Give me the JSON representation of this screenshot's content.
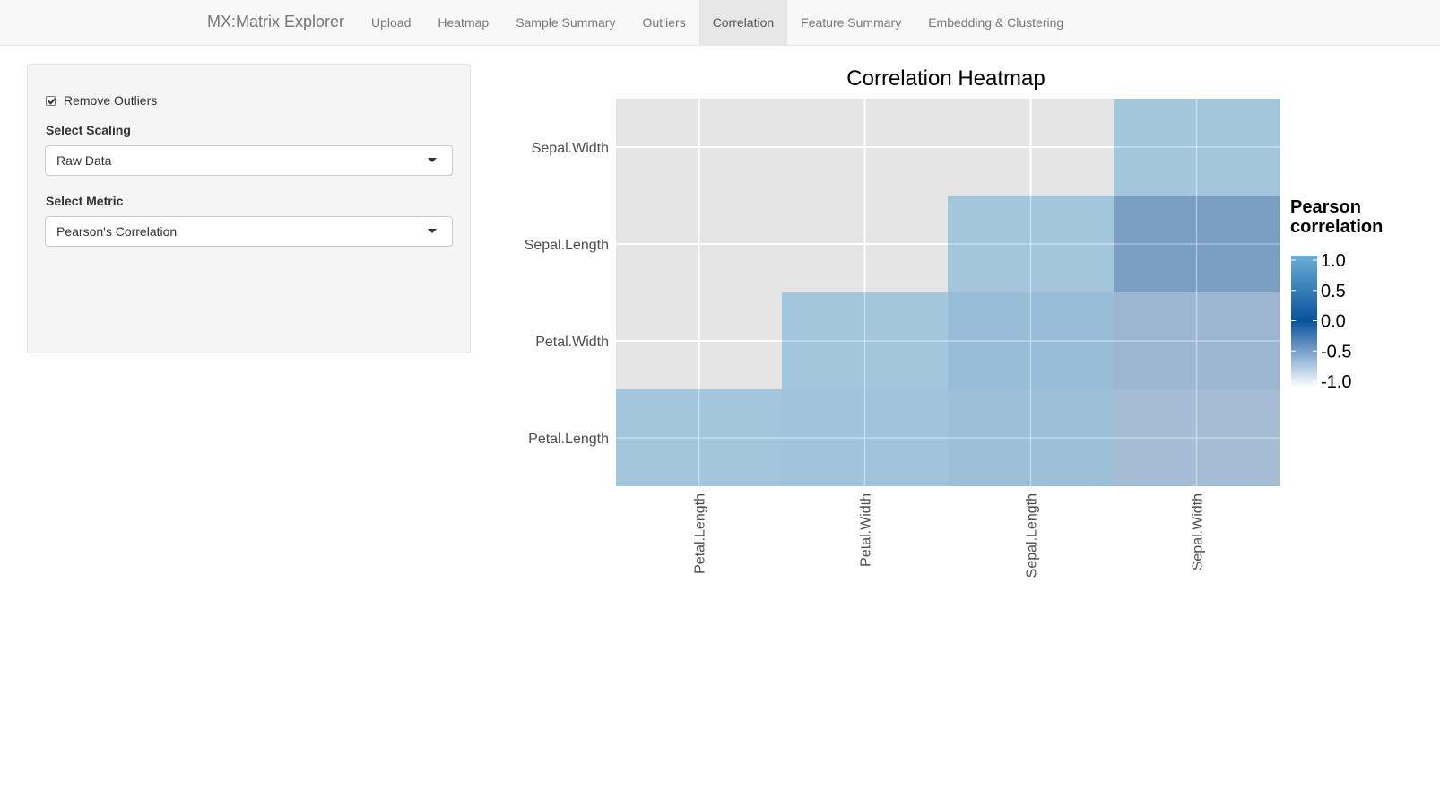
{
  "navbar": {
    "brand": "MX:Matrix Explorer",
    "tabs": [
      {
        "label": "Upload",
        "active": false
      },
      {
        "label": "Heatmap",
        "active": false
      },
      {
        "label": "Sample Summary",
        "active": false
      },
      {
        "label": "Outliers",
        "active": false
      },
      {
        "label": "Correlation",
        "active": true
      },
      {
        "label": "Feature Summary",
        "active": false
      },
      {
        "label": "Embedding & Clustering",
        "active": false
      }
    ]
  },
  "sidebar": {
    "remove_outliers_label": "Remove Outliers",
    "remove_outliers_checked": true,
    "scaling_label": "Select Scaling",
    "scaling_value": "Raw Data",
    "metric_label": "Select Metric",
    "metric_value": "Pearson's Correlation"
  },
  "chart_data": {
    "type": "heatmap",
    "title": "Correlation Heatmap",
    "x_categories": [
      "Petal.Length",
      "Petal.Width",
      "Sepal.Length",
      "Sepal.Width"
    ],
    "y_categories": [
      "Petal.Length",
      "Petal.Width",
      "Sepal.Length",
      "Sepal.Width"
    ],
    "cells": [
      {
        "x": "Petal.Length",
        "y": "Petal.Length",
        "value": 1.0
      },
      {
        "x": "Petal.Width",
        "y": "Petal.Length",
        "value": 0.96
      },
      {
        "x": "Sepal.Length",
        "y": "Petal.Length",
        "value": 0.87
      },
      {
        "x": "Sepal.Width",
        "y": "Petal.Length",
        "value": -0.43
      },
      {
        "x": "Petal.Width",
        "y": "Petal.Width",
        "value": 1.0
      },
      {
        "x": "Sepal.Length",
        "y": "Petal.Width",
        "value": 0.82
      },
      {
        "x": "Sepal.Width",
        "y": "Petal.Width",
        "value": -0.37
      },
      {
        "x": "Sepal.Length",
        "y": "Sepal.Length",
        "value": 1.0
      },
      {
        "x": "Sepal.Width",
        "y": "Sepal.Length",
        "value": -0.12
      },
      {
        "x": "Sepal.Width",
        "y": "Sepal.Width",
        "value": 1.0
      }
    ],
    "legend": {
      "title_lines": [
        "Pearson",
        "correlation"
      ],
      "ticks": [
        "1.0",
        "0.5",
        "0.0",
        "-0.5",
        "-1.0"
      ],
      "range": [
        -1,
        1
      ]
    },
    "colors": {
      "panel_bg": "#e5e5e5",
      "grid": "#ffffff"
    },
    "grid": true,
    "legend_position": "right"
  }
}
